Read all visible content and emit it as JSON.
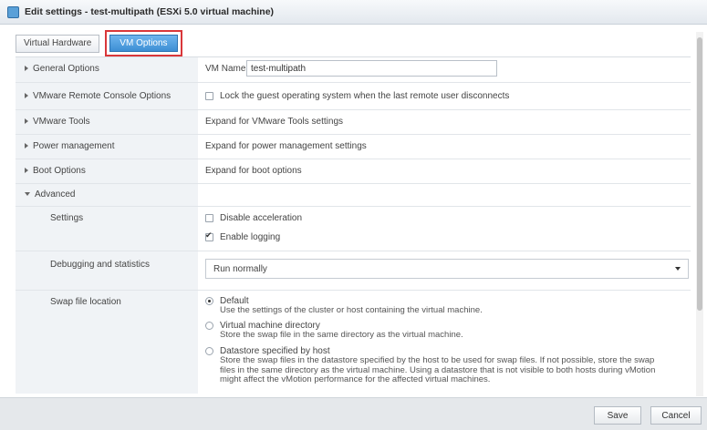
{
  "window": {
    "title": "Edit settings - test-multipath (ESXi 5.0 virtual machine)"
  },
  "tabs": [
    {
      "label": "Virtual Hardware",
      "active": false
    },
    {
      "label": "VM Options",
      "active": true
    }
  ],
  "rows": {
    "general": {
      "label": "General Options",
      "vm_name_label": "VM Name:",
      "vm_name_value": "test-multipath"
    },
    "vmrc": {
      "label": "VMware Remote Console Options",
      "checkbox_label": "Lock the guest operating system when the last remote user disconnects",
      "checked": false
    },
    "tools": {
      "label": "VMware Tools",
      "text": "Expand for VMware Tools settings"
    },
    "power": {
      "label": "Power management",
      "text": "Expand for power management settings"
    },
    "boot": {
      "label": "Boot Options",
      "text": "Expand for boot options"
    },
    "advanced": {
      "label": "Advanced"
    },
    "settings": {
      "label": "Settings",
      "disable_acceleration": {
        "label": "Disable acceleration",
        "checked": false
      },
      "enable_logging": {
        "label": "Enable logging",
        "checked": true
      }
    },
    "debugging": {
      "label": "Debugging and statistics",
      "selected": "Run normally"
    },
    "swap": {
      "label": "Swap file location",
      "options": [
        {
          "title": "Default",
          "desc": "Use the settings of the cluster or host containing the virtual machine.",
          "checked": true
        },
        {
          "title": "Virtual machine directory",
          "desc": "Store the swap file in the same directory as the virtual machine.",
          "checked": false
        },
        {
          "title": "Datastore specified by host",
          "desc": "Store the swap files in the datastore specified by the host to be used for swap files. If not possible, store the swap files in the same directory as the virtual machine. Using a datastore that is not visible to both hosts during vMotion might affect the vMotion performance for the affected virtual machines.",
          "checked": false
        }
      ]
    }
  },
  "footer": {
    "save_label": "Save",
    "cancel_label": "Cancel"
  },
  "colors": {
    "accent": "#3d8fd4",
    "highlight_border": "#d9373a",
    "left_column_bg": "#f0f3f6"
  },
  "icons": {
    "title_icon": "vm-settings-icon",
    "caret_collapsed": "caret-right-icon",
    "caret_expanded": "caret-down-icon",
    "dropdown": "chevron-down-icon"
  }
}
